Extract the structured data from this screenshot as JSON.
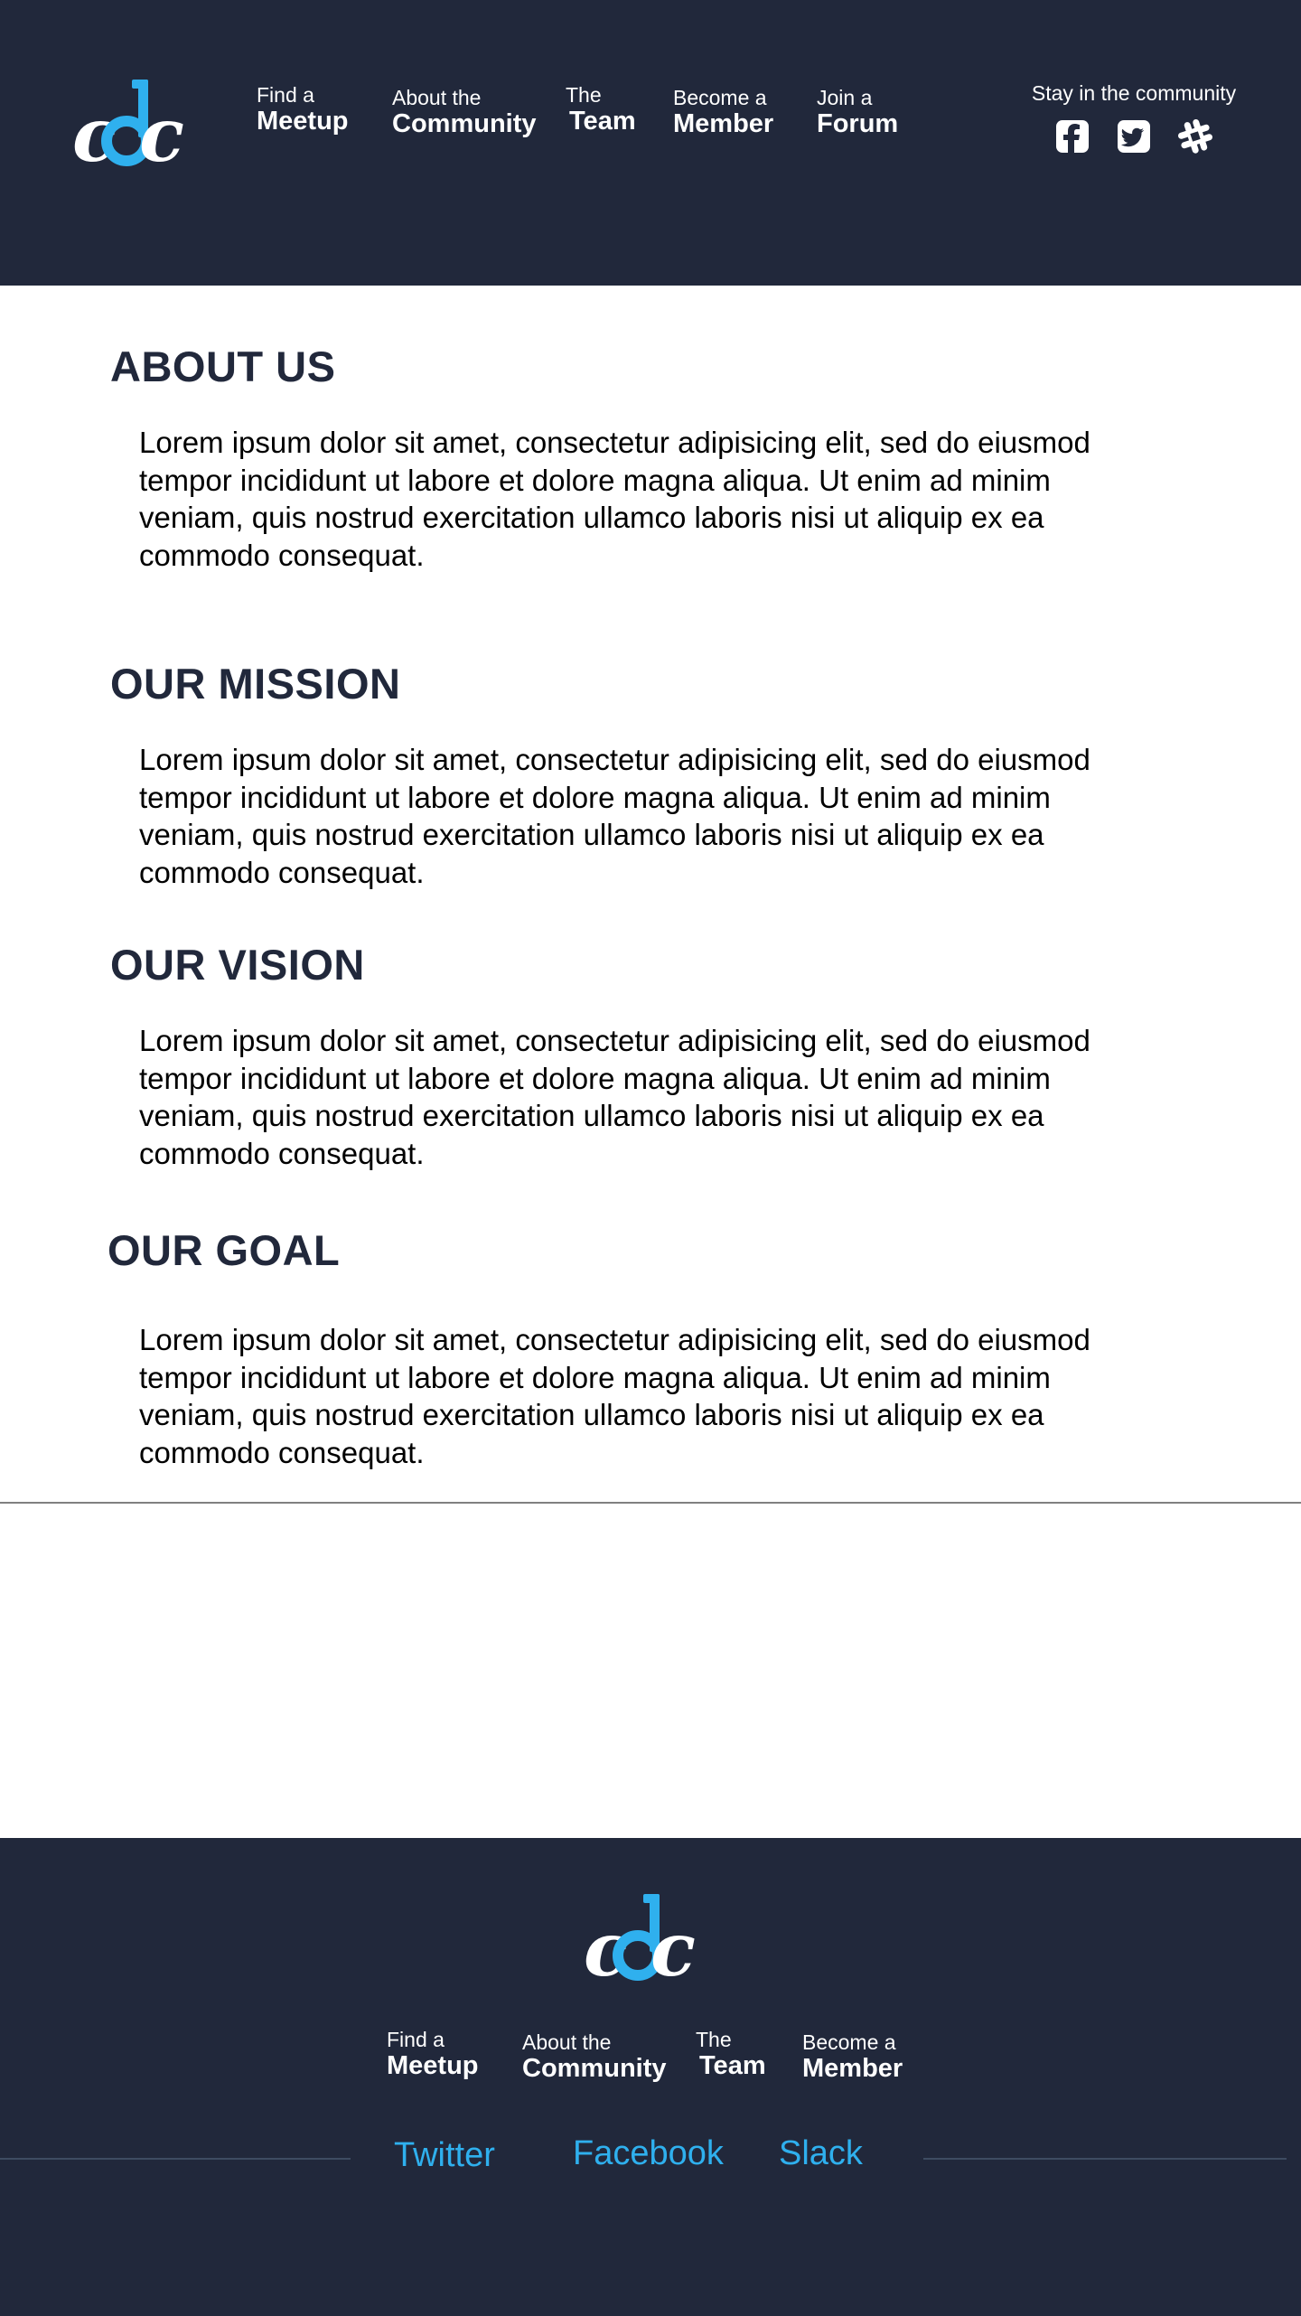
{
  "brand": {
    "logo_text": "cdc",
    "accent_color": "#2fb0ee",
    "dark_color": "#21283b"
  },
  "header": {
    "nav": [
      {
        "small": "Find a",
        "big": "Meetup"
      },
      {
        "small": "About the",
        "big": "Community"
      },
      {
        "small": "The",
        "big": "Team"
      },
      {
        "small": "Become a",
        "big": "Member"
      },
      {
        "small": "Join a",
        "big": "Forum"
      }
    ],
    "community_label": "Stay in the community",
    "social_icons": [
      "facebook-icon",
      "twitter-icon",
      "slack-icon"
    ]
  },
  "sections": [
    {
      "title": "ABOUT US",
      "text": "Lorem ipsum dolor sit amet, consectetur adipisicing elit, sed do eiusmod tempor incididunt ut labore et dolore magna aliqua. Ut enim ad minim veniam, quis nostrud exercitation ullamco laboris nisi ut aliquip ex ea commodo consequat."
    },
    {
      "title": "OUR MISSION",
      "text": "Lorem ipsum dolor sit amet, consectetur adipisicing elit, sed do eiusmod tempor incididunt ut labore et dolore magna aliqua. Ut enim ad minim veniam, quis nostrud exercitation ullamco laboris nisi ut aliquip ex ea commodo consequat."
    },
    {
      "title": "OUR VISION",
      "text": "Lorem ipsum dolor sit amet, consectetur adipisicing elit, sed do eiusmod tempor incididunt ut labore et dolore magna aliqua. Ut enim ad minim veniam, quis nostrud exercitation ullamco laboris nisi ut aliquip ex ea commodo consequat."
    },
    {
      "title": "OUR GOAL",
      "text": "Lorem ipsum dolor sit amet, consectetur adipisicing elit, sed do eiusmod tempor incididunt ut labore et dolore magna aliqua. Ut enim ad minim veniam, quis nostrud exercitation ullamco laboris nisi ut aliquip ex ea commodo consequat."
    }
  ],
  "footer": {
    "nav": [
      {
        "small": "Find a",
        "big": "Meetup"
      },
      {
        "small": "About the",
        "big": "Community"
      },
      {
        "small": "The",
        "big": "Team"
      },
      {
        "small": "Become a",
        "big": "Member"
      }
    ],
    "links": [
      "Twitter",
      "Facebook",
      "Slack"
    ]
  }
}
